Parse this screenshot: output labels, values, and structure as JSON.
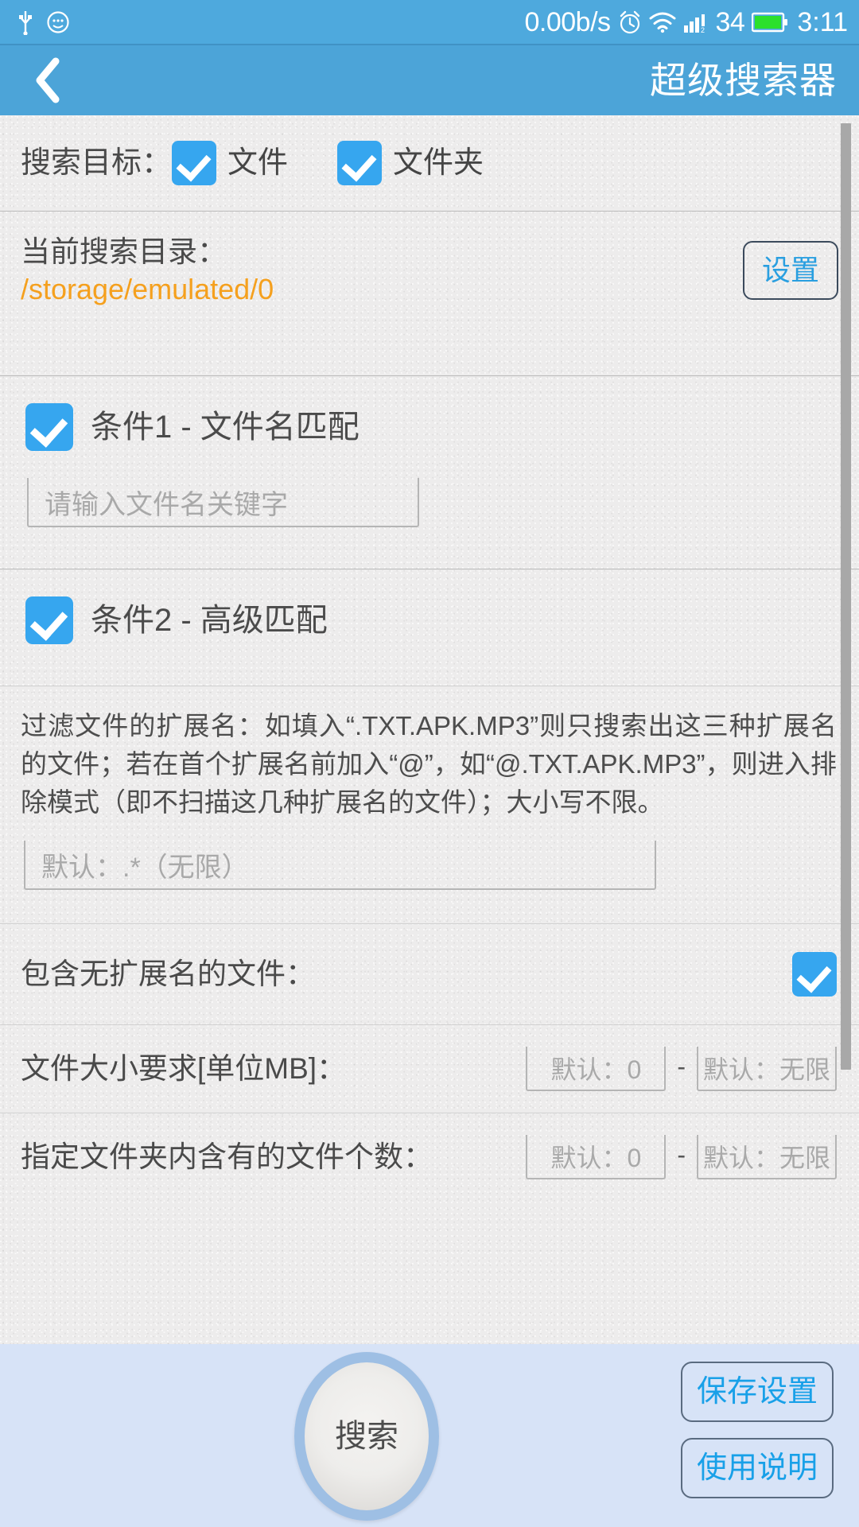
{
  "status_bar": {
    "network_speed": "0.00b/s",
    "battery_level": "34",
    "time": "3:11",
    "icons": [
      "usb-icon",
      "emoji-face-icon",
      "alarm-icon",
      "wifi-icon",
      "signal-icon",
      "battery-icon"
    ]
  },
  "app_bar": {
    "back_label": "‹",
    "title": "超级搜索器"
  },
  "search_target": {
    "label": "搜索目标：",
    "options": [
      {
        "label": "文件",
        "checked": true
      },
      {
        "label": "文件夹",
        "checked": true
      }
    ]
  },
  "current_directory": {
    "label": "当前搜索目录：",
    "path": "/storage/emulated/0",
    "settings_button": "设置"
  },
  "condition1": {
    "checked": true,
    "title": "条件1 - 文件名匹配",
    "keyword_placeholder": "请输入文件名关键字",
    "keyword_value": ""
  },
  "condition2": {
    "checked": true,
    "title": "条件2 - 高级匹配",
    "description": "过滤文件的扩展名：如填入“.TXT.APK.MP3”则只搜索出这三种扩展名的文件；若在首个扩展名前加入“@”，如“@.TXT.APK.MP3”，则进入排除模式（即不扫描这几种扩展名的文件）；大小写不限。",
    "ext_placeholder": "默认：.*（无限）",
    "ext_value": "",
    "include_no_ext": {
      "label": "包含无扩展名的文件：",
      "checked": true
    },
    "file_size": {
      "label": "文件大小要求[单位MB]：",
      "min_placeholder": "默认：0",
      "max_placeholder": "默认：无限",
      "separator": "-",
      "min_value": "",
      "max_value": ""
    },
    "folder_count": {
      "label": "指定文件夹内含有的文件个数：",
      "min_placeholder": "默认：0",
      "max_placeholder": "默认：无限",
      "separator": "-",
      "min_value": "",
      "max_value": ""
    }
  },
  "bottom_bar": {
    "search_button": "搜索",
    "save_settings_button": "保存设置",
    "instructions_button": "使用说明"
  },
  "colors": {
    "status_bar": "#4ea9dd",
    "app_bar": "#4ca4d8",
    "accent_checkbox": "#36a6ef",
    "path_text": "#f5a01e",
    "link_blue": "#18a0e8",
    "bottom_bar": "#d7e3f7",
    "page_background": "#edecec"
  }
}
